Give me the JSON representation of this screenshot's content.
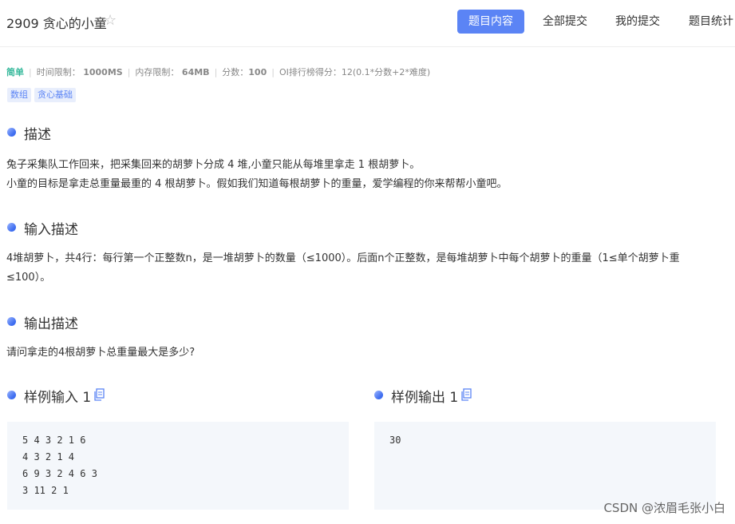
{
  "header": {
    "problem_title": "2909 贪心的小童",
    "star_icon": "☆",
    "tabs": [
      {
        "label": "题目内容",
        "active": true
      },
      {
        "label": "全部提交",
        "active": false
      },
      {
        "label": "我的提交",
        "active": false
      },
      {
        "label": "题目统计",
        "active": false
      }
    ]
  },
  "meta": {
    "difficulty": "简单",
    "time_label": "时间限制：",
    "time_value": "1000MS",
    "memory_label": "内存限制：",
    "memory_value": "64MB",
    "score_label": "分数：",
    "score_value": "100",
    "rank_label": "OI排行榜得分：",
    "rank_value": "12(0.1*分数+2*难度)"
  },
  "tags": [
    "数组",
    "贪心基础"
  ],
  "sections": {
    "description": {
      "title": "描述",
      "lines": [
        "兔子采集队工作回来，把采集回来的胡萝卜分成 4 堆,小童只能从每堆里拿走 1 根胡萝卜。",
        "小童的目标是拿走总重量最重的 4 根胡萝卜。假如我们知道每根胡萝卜的重量，爱学编程的你来帮帮小童吧。"
      ]
    },
    "input": {
      "title": "输入描述",
      "lines": [
        "4堆胡萝卜，共4行：每行第一个正整数n，是一堆胡萝卜的数量（≤1000）。后面n个正整数，是每堆胡萝卜中每个胡萝卜的重量（1≤单个胡萝卜重",
        "≤100）。"
      ]
    },
    "output": {
      "title": "输出描述",
      "lines": [
        "请问拿走的4根胡萝卜总重量最大是多少?"
      ]
    },
    "sample_input": {
      "title": "样例输入 1",
      "lines": [
        "5 4 3 2 1 6",
        "4 3 2 1 4",
        "6 9 3 2 4 6 3",
        "3 11 2 1"
      ]
    },
    "sample_output": {
      "title": "样例输出 1",
      "lines": [
        "30"
      ]
    }
  },
  "watermark": "CSDN @浓眉毛张小白",
  "colors": {
    "accent": "#5b84f5",
    "easy": "#35b89b",
    "code_bg": "#f4f7fb"
  }
}
